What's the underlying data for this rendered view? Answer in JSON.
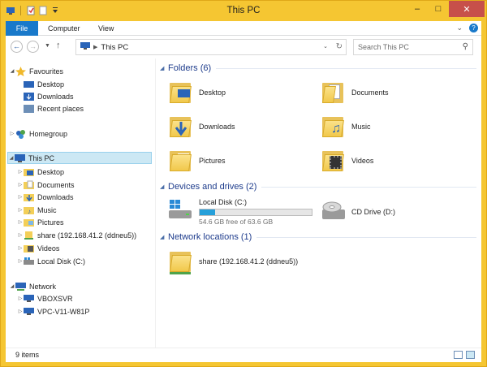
{
  "window": {
    "title": "This PC"
  },
  "ribbon": {
    "tabs": [
      "File",
      "Computer",
      "View"
    ]
  },
  "address": {
    "path": "This PC",
    "search_placeholder": "Search This PC"
  },
  "nav": {
    "favourites": {
      "label": "Favourites",
      "items": [
        "Desktop",
        "Downloads",
        "Recent places"
      ]
    },
    "homegroup": "Homegroup",
    "thispc": {
      "label": "This PC",
      "items": [
        "Desktop",
        "Documents",
        "Downloads",
        "Music",
        "Pictures",
        "share (192.168.41.2 (ddneu5))",
        "Videos",
        "Local Disk (C:)"
      ]
    },
    "network": {
      "label": "Network",
      "items": [
        "VBOXSVR",
        "VPC-V11-W81P"
      ]
    }
  },
  "main": {
    "folders_title": "Folders (6)",
    "folders": [
      "Desktop",
      "Documents",
      "Downloads",
      "Music",
      "Pictures",
      "Videos"
    ],
    "drives_title": "Devices and drives (2)",
    "local_disk": {
      "name": "Local Disk (C:)",
      "free": "54.6 GB free of 63.6 GB",
      "used_fraction": 0.14
    },
    "cd_drive": "CD Drive (D:)",
    "network_title": "Network locations (1)",
    "network_share": "share (192.168.41.2 (ddneu5))"
  },
  "status": {
    "items": "9 items"
  }
}
